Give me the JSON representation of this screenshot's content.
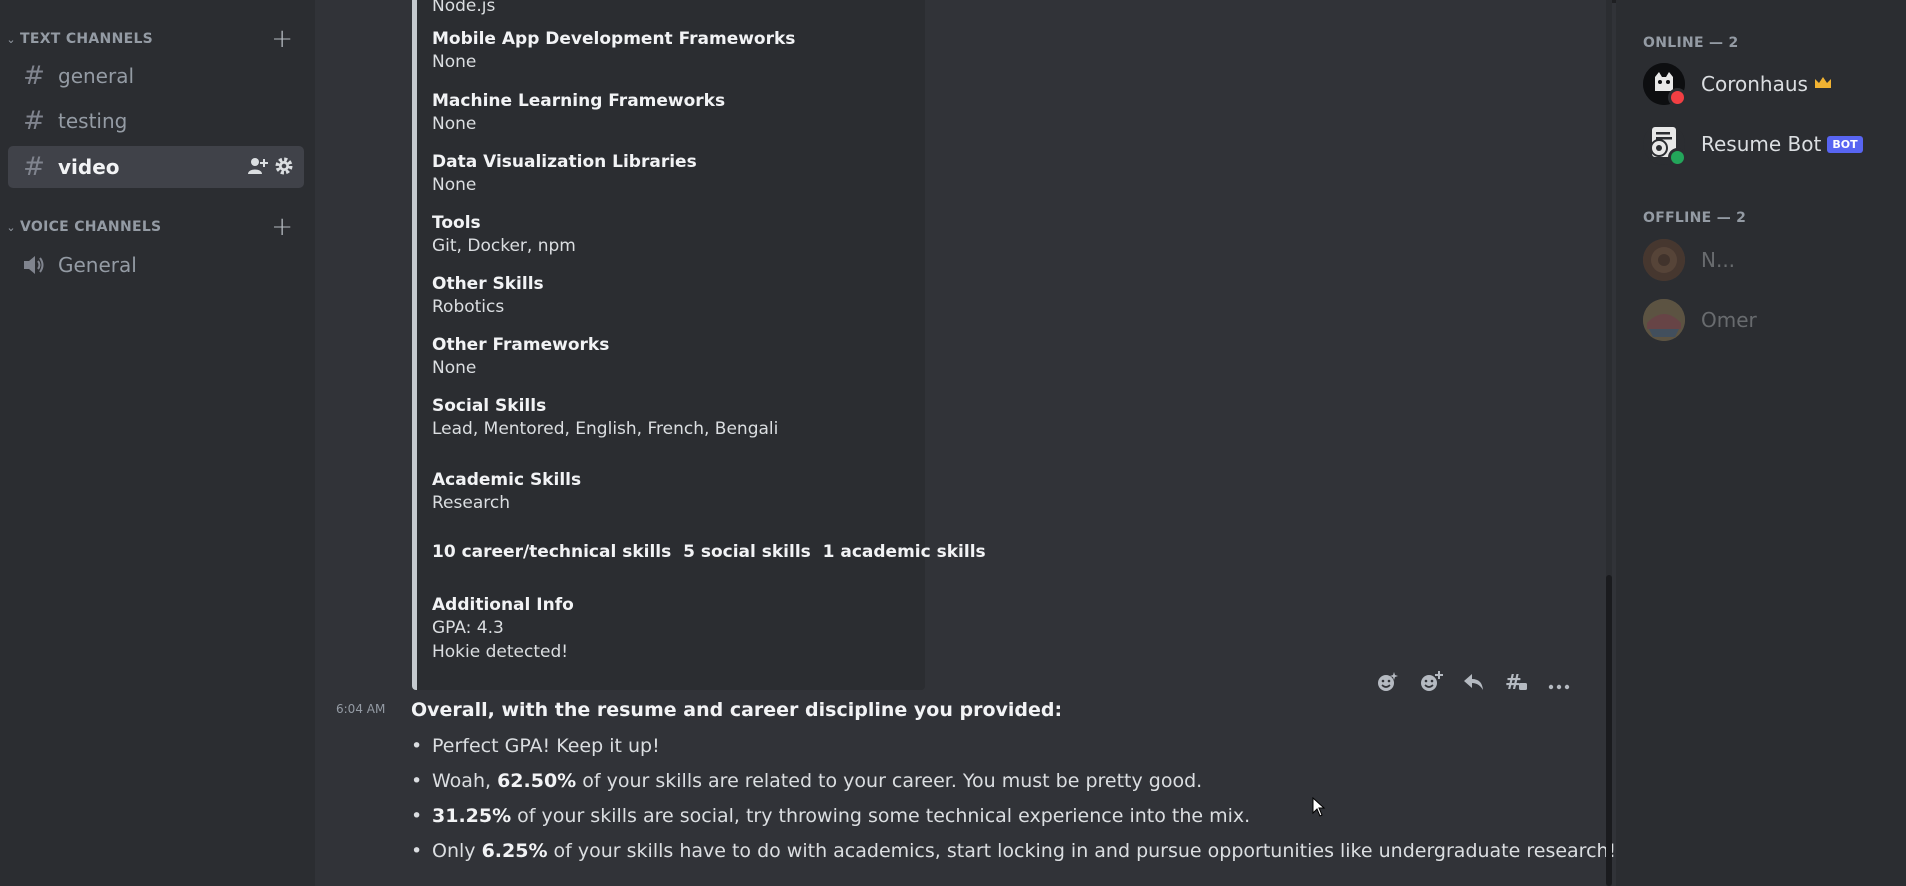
{
  "sidebar": {
    "text_category": "TEXT CHANNELS",
    "voice_category": "VOICE CHANNELS",
    "text_channels": [
      {
        "label": "general"
      },
      {
        "label": "testing"
      },
      {
        "label": "video",
        "active": true
      }
    ],
    "voice_channels": [
      {
        "label": "General"
      }
    ]
  },
  "embed": {
    "top_value": "Node.js",
    "fields": [
      {
        "name": "Mobile App Development Frameworks",
        "value": "None"
      },
      {
        "name": "Machine Learning Frameworks",
        "value": "None"
      },
      {
        "name": "Data Visualization Libraries",
        "value": "None"
      },
      {
        "name": "Tools",
        "value": "Git, Docker, npm"
      },
      {
        "name": "Other Skills",
        "value": "Robotics"
      },
      {
        "name": "Other Frameworks",
        "value": "None"
      },
      {
        "name": "Social Skills",
        "value": "Lead, Mentored, English, French, Bengali"
      },
      {
        "name": "Academic Skills",
        "value": "Research"
      }
    ],
    "summary": "10 career/technical skills  5 social skills  1 academic skills",
    "additional_info": {
      "name": "Additional Info",
      "line1": "GPA: 4.3",
      "line2": "Hokie detected!"
    }
  },
  "message": {
    "timestamp": "6:04 AM",
    "title": "Overall, with the resume and career discipline you provided:",
    "bullets": [
      {
        "pre": "Perfect GPA! Keep it up!",
        "bold": "",
        "post": ""
      },
      {
        "pre": "Woah, ",
        "bold": "62.50%",
        "post": " of your skills are related to your career. You must be pretty good."
      },
      {
        "pre": "",
        "bold": "31.25%",
        "post": " of your skills are social, try throwing some technical experience into the mix."
      },
      {
        "pre": "Only ",
        "bold": "6.25%",
        "post": " of your skills have to do with academics, start locking in and pursue opportunities like undergraduate research!"
      }
    ]
  },
  "members": {
    "online_header": "ONLINE — 2",
    "offline_header": "OFFLINE — 2",
    "online": [
      {
        "name": "Coronhaus",
        "badge": "crown-icon",
        "status": "dnd",
        "status_color": "#f23f43"
      },
      {
        "name": "Resume Bot",
        "badge": "BOT",
        "status": "online",
        "status_color": "#23a55a"
      }
    ],
    "offline": [
      {
        "name": "N..."
      },
      {
        "name": "Omer"
      }
    ]
  },
  "colors": {
    "background": "#313338",
    "sidebar": "#2b2d31",
    "bot_tag": "#5865f2",
    "crown": "#f0b232"
  }
}
